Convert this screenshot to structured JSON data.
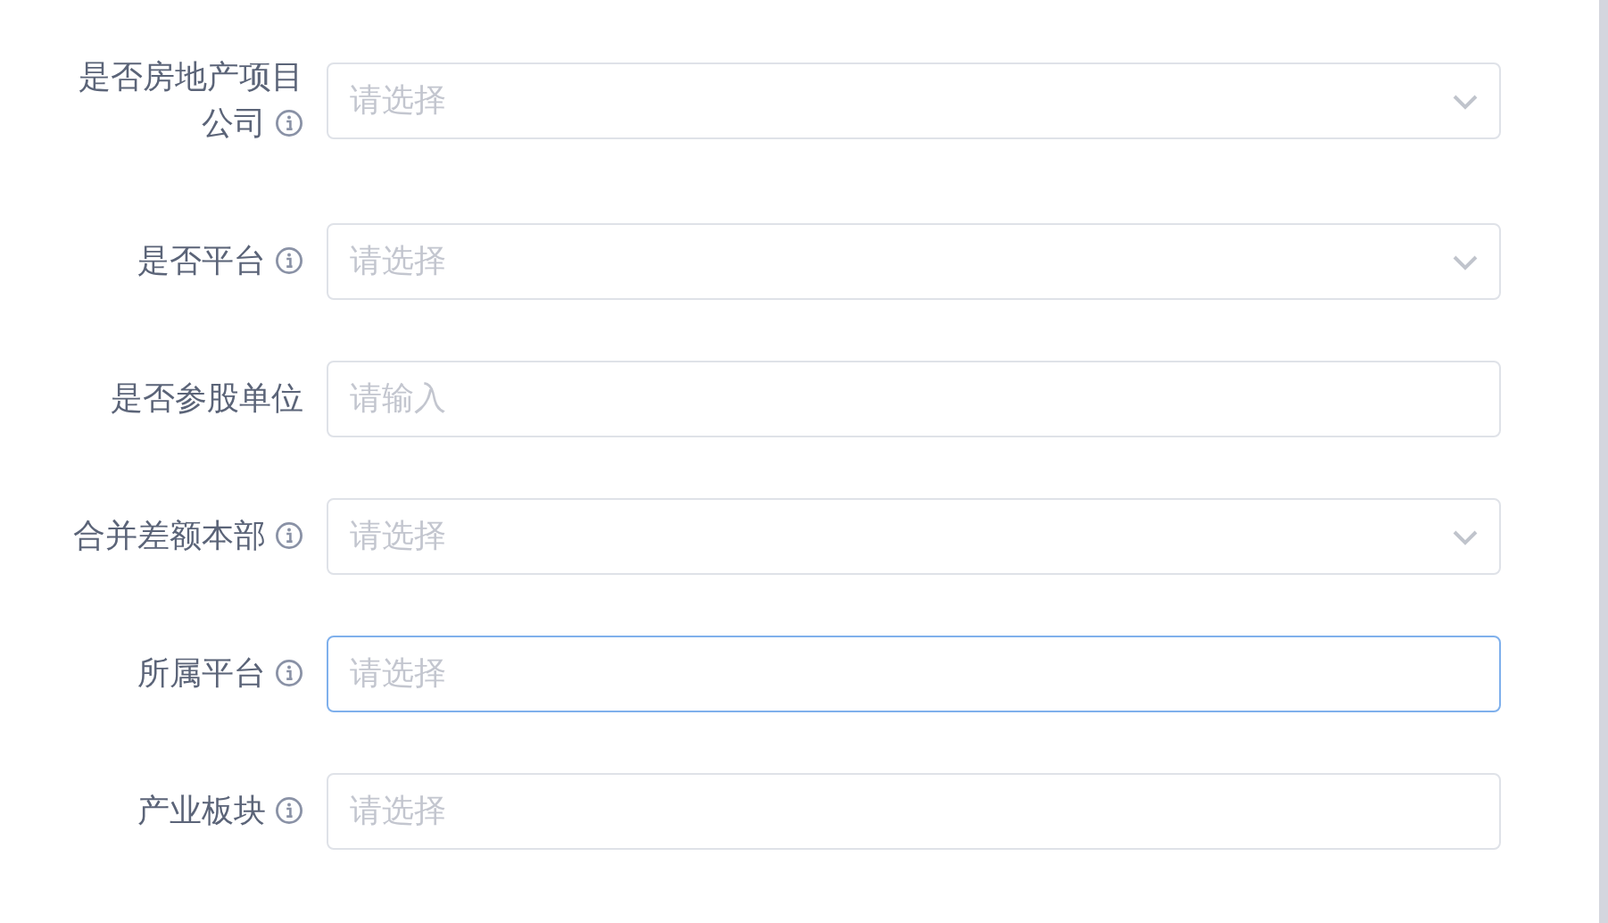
{
  "form": {
    "fields": [
      {
        "label": "是否房地产项目公司",
        "info": true,
        "kind": "select",
        "placeholder": "请选择",
        "focused": false
      },
      {
        "label": "是否平台",
        "info": true,
        "kind": "select",
        "placeholder": "请选择",
        "focused": false
      },
      {
        "label": "是否参股单位",
        "info": false,
        "kind": "input",
        "placeholder": "请输入",
        "focused": false
      },
      {
        "label": "合并差额本部",
        "info": true,
        "kind": "select",
        "placeholder": "请选择",
        "focused": false
      },
      {
        "label": "所属平台",
        "info": true,
        "kind": "input",
        "placeholder": "请选择",
        "focused": true
      },
      {
        "label": "产业板块",
        "info": true,
        "kind": "input",
        "placeholder": "请选择",
        "focused": false
      }
    ]
  }
}
